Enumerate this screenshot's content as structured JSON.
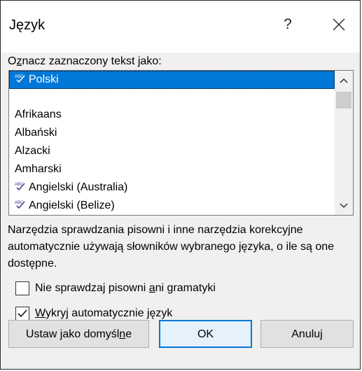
{
  "dialog": {
    "title": "Język",
    "help_label": "?"
  },
  "list": {
    "label": "Oznacz zaznaczony tekst jako:",
    "items": [
      {
        "label": "Polski",
        "selected": true,
        "spell_icon": true
      },
      {
        "label": "",
        "selected": false,
        "spell_icon": false
      },
      {
        "label": "Afrikaans",
        "selected": false,
        "spell_icon": false
      },
      {
        "label": "Albański",
        "selected": false,
        "spell_icon": false
      },
      {
        "label": "Alzacki",
        "selected": false,
        "spell_icon": false
      },
      {
        "label": "Amharski",
        "selected": false,
        "spell_icon": false
      },
      {
        "label": "Angielski (Australia)",
        "selected": false,
        "spell_icon": true
      },
      {
        "label": "Angielski (Belize)",
        "selected": false,
        "spell_icon": true
      }
    ]
  },
  "description": "Narzędzia sprawdzania pisowni i inne narzędzia korekcyjne automatycznie używają słowników wybranego języka, o ile są one dostępne.",
  "checkboxes": {
    "no_check": {
      "label": "Nie sprawdzaj pisowni ani gramatyki",
      "checked": false
    },
    "detect": {
      "label": "Wykryj automatycznie język",
      "checked": true
    }
  },
  "buttons": {
    "set_default": "Ustaw jako domyślne",
    "ok": "OK",
    "cancel": "Anuluj"
  },
  "colors": {
    "selection": "#0078d7",
    "dialog_bg": "#f0f0f0"
  },
  "icons": {
    "spelling": "spelling-check-icon",
    "help": "help-icon",
    "close": "close-icon",
    "scroll_up": "chevron-up-icon",
    "scroll_down": "chevron-down-icon",
    "check": "checkmark-icon"
  }
}
